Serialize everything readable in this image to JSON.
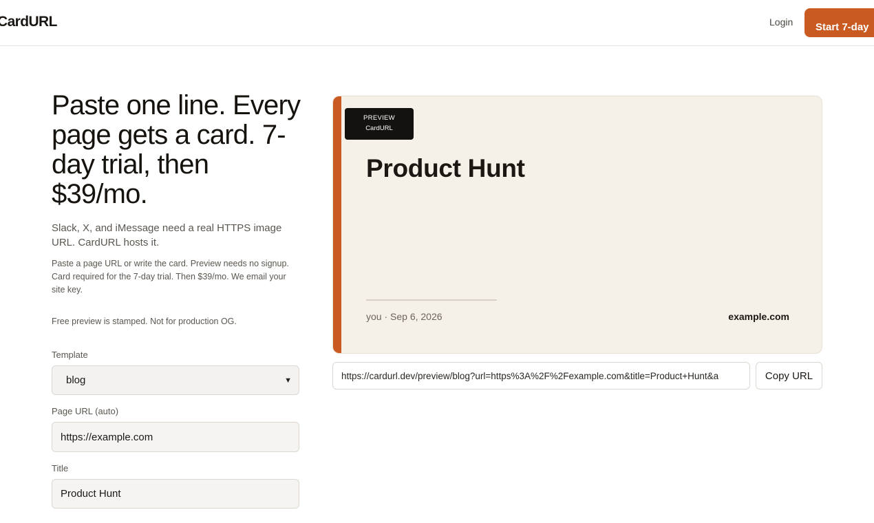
{
  "header": {
    "logo": "CardURL",
    "login": "Login",
    "cta": "Start 7-day"
  },
  "hero": {
    "headline": "Paste one line. Every page gets a card. 7-day trial, then $39/mo.",
    "subtitle": "Slack, X, and iMessage need a real HTTPS image URL. CardURL hosts it.",
    "fine_print": "Paste a page URL or write the card. Preview needs no signup. Card required for the 7-day trial. Then $39/mo. We email your site key.",
    "stamp_note": "Free preview is stamped. Not for production OG."
  },
  "form": {
    "template_label": "Template",
    "template_value": "blog",
    "page_url_label": "Page URL (auto)",
    "page_url_value": "https://example.com",
    "title_label": "Title",
    "title_value": "Product Hunt"
  },
  "preview": {
    "badge_line1": "PREVIEW",
    "badge_line2": "CardURL",
    "title": "Product Hunt",
    "meta": "you · Sep 6, 2026",
    "domain": "example.com",
    "url": "https://cardurl.dev/preview/blog?url=https%3A%2F%2Fexample.com&title=Product+Hunt&a",
    "copy_label": "Copy URL"
  },
  "colors": {
    "accent": "#c95a22",
    "card_bg": "#f5f0e8",
    "badge_bg": "#141210"
  },
  "icons": {
    "select_chevron": "chevron-down-icon"
  }
}
